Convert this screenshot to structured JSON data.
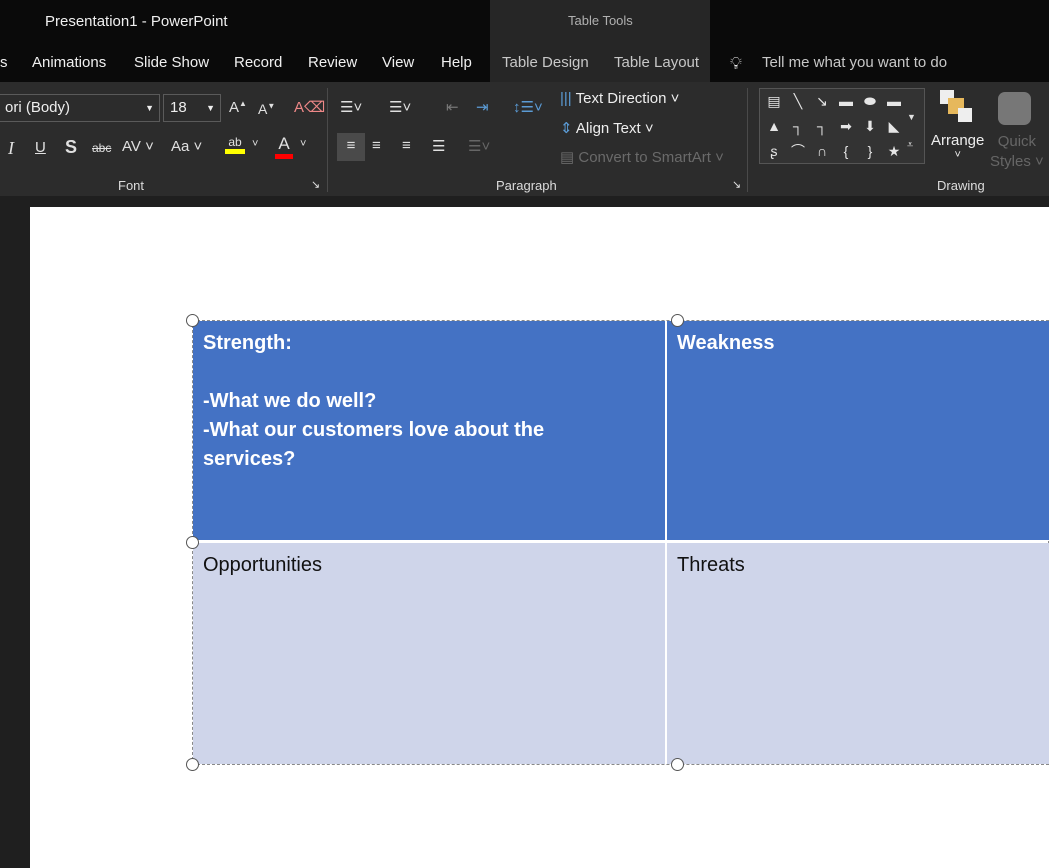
{
  "window": {
    "title": "Presentation1  -  PowerPoint",
    "contextual_group": "Table Tools"
  },
  "tabs": [
    {
      "label": "s"
    },
    {
      "label": "Animations"
    },
    {
      "label": "Slide Show"
    },
    {
      "label": "Record"
    },
    {
      "label": "Review"
    },
    {
      "label": "View"
    },
    {
      "label": "Help"
    },
    {
      "label": "Table Design"
    },
    {
      "label": "Table Layout"
    }
  ],
  "tell_me": {
    "placeholder": "Tell me what you want to do"
  },
  "ribbon": {
    "font": {
      "group_label": "Font",
      "font_name": "ori (Body)",
      "font_size": "18",
      "highlight_color": "#ffff00",
      "font_color": "#ff0000"
    },
    "paragraph": {
      "group_label": "Paragraph",
      "text_direction": "Text Direction",
      "align_text": "Align Text",
      "convert_smartart": "Convert to SmartArt"
    },
    "drawing": {
      "group_label": "Drawing",
      "arrange": "Arrange",
      "quick_styles_1": "Quick",
      "quick_styles_2": "Styles"
    }
  },
  "table": {
    "header_color": "#4472c4",
    "body_color": "#cfd5ea",
    "rows": [
      [
        "Strength:\n\n-What we do well?\n-What our customers love about the\nservices?",
        "Weakness"
      ],
      [
        "Opportunities",
        "Threats"
      ]
    ]
  }
}
